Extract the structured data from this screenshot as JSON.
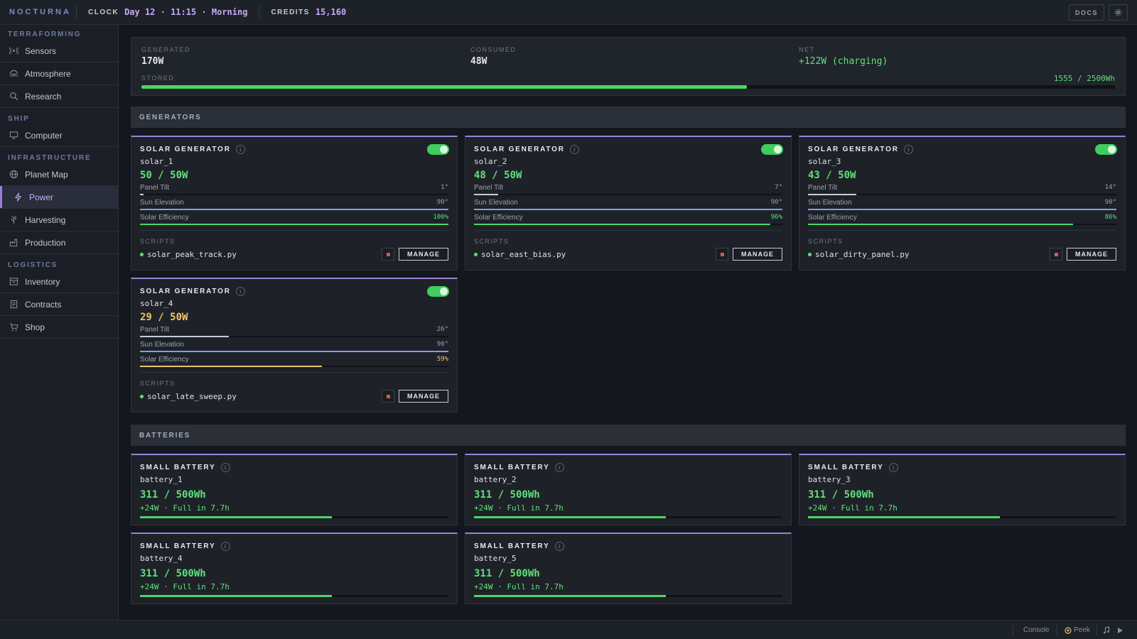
{
  "app": {
    "brand": "NOCTURNA"
  },
  "topbar": {
    "clock_label": "CLOCK",
    "clock_value": "Day 12 · 11:15 · Morning",
    "credits_label": "CREDITS",
    "credits_value": "15,160",
    "docs_label": "DOCS",
    "settings_icon": "gear-icon"
  },
  "sidebar": {
    "sections": [
      {
        "title": "TERRAFORMING",
        "items": [
          {
            "label": "Sensors",
            "icon": "sensor-icon"
          },
          {
            "label": "Atmosphere",
            "icon": "atmosphere-icon"
          },
          {
            "label": "Research",
            "icon": "research-icon"
          }
        ]
      },
      {
        "title": "SHIP",
        "items": [
          {
            "label": "Computer",
            "icon": "computer-icon"
          }
        ]
      },
      {
        "title": "INFRASTRUCTURE",
        "items": [
          {
            "label": "Planet Map",
            "icon": "globe-icon"
          },
          {
            "label": "Power",
            "icon": "bolt-icon",
            "active": true
          },
          {
            "label": "Harvesting",
            "icon": "harvest-icon"
          },
          {
            "label": "Production",
            "icon": "factory-icon"
          }
        ]
      },
      {
        "title": "LOGISTICS",
        "items": [
          {
            "label": "Inventory",
            "icon": "inventory-icon"
          },
          {
            "label": "Contracts",
            "icon": "contract-icon"
          },
          {
            "label": "Shop",
            "icon": "cart-icon"
          }
        ]
      }
    ]
  },
  "summary": {
    "generated_label": "GENERATED",
    "generated_value": "170W",
    "consumed_label": "CONSUMED",
    "consumed_value": "48W",
    "net_label": "NET",
    "net_value": "+122W (charging)",
    "stored_label": "STORED",
    "stored_value": "1555 / 2500Wh",
    "stored_fraction": 0.622
  },
  "generators": {
    "section_title": "GENERATORS",
    "scripts_label": "SCRIPTS",
    "manage_label": "MANAGE",
    "metric_labels": {
      "tilt": "Panel Tilt",
      "sun": "Sun Elevation",
      "eff": "Solar Efficiency"
    },
    "items": [
      {
        "type": "SOLAR GENERATOR",
        "id": "solar_1",
        "power": "50 / 50W",
        "status": "good",
        "enabled": true,
        "tilt": "1°",
        "tilt_fraction": 0.011,
        "sun": "90°",
        "sun_fraction": 1.0,
        "eff": "100%",
        "eff_fraction": 1.0,
        "script": "solar_peak_track.py"
      },
      {
        "type": "SOLAR GENERATOR",
        "id": "solar_2",
        "power": "48 / 50W",
        "status": "good",
        "enabled": true,
        "tilt": "7°",
        "tilt_fraction": 0.078,
        "sun": "90°",
        "sun_fraction": 1.0,
        "eff": "96%",
        "eff_fraction": 0.96,
        "script": "solar_east_bias.py"
      },
      {
        "type": "SOLAR GENERATOR",
        "id": "solar_3",
        "power": "43 / 50W",
        "status": "good",
        "enabled": true,
        "tilt": "14°",
        "tilt_fraction": 0.156,
        "sun": "90°",
        "sun_fraction": 1.0,
        "eff": "86%",
        "eff_fraction": 0.86,
        "script": "solar_dirty_panel.py"
      },
      {
        "type": "SOLAR GENERATOR",
        "id": "solar_4",
        "power": "29 / 50W",
        "status": "warn",
        "enabled": true,
        "tilt": "26°",
        "tilt_fraction": 0.289,
        "sun": "90°",
        "sun_fraction": 1.0,
        "eff": "59%",
        "eff_fraction": 0.59,
        "script": "solar_late_sweep.py"
      }
    ]
  },
  "batteries": {
    "section_title": "BATTERIES",
    "items": [
      {
        "type": "SMALL BATTERY",
        "id": "battery_1",
        "energy": "311 / 500Wh",
        "rate": "+24W · Full in 7.7h",
        "fraction": 0.622
      },
      {
        "type": "SMALL BATTERY",
        "id": "battery_2",
        "energy": "311 / 500Wh",
        "rate": "+24W · Full in 7.7h",
        "fraction": 0.622
      },
      {
        "type": "SMALL BATTERY",
        "id": "battery_3",
        "energy": "311 / 500Wh",
        "rate": "+24W · Full in 7.7h",
        "fraction": 0.622
      },
      {
        "type": "SMALL BATTERY",
        "id": "battery_4",
        "energy": "311 / 500Wh",
        "rate": "+24W · Full in 7.7h",
        "fraction": 0.622
      },
      {
        "type": "SMALL BATTERY",
        "id": "battery_5",
        "energy": "311 / 500Wh",
        "rate": "+24W · Full in 7.7h",
        "fraction": 0.622
      }
    ]
  },
  "bottombar": {
    "console_label": "Console",
    "peek_label": "Peek",
    "music_icon": "music-icon",
    "play_icon": "play-icon"
  },
  "colors": {
    "accent": "#9b7ae0",
    "good": "#5fe07b",
    "warn": "#f2c56b",
    "stop": "#e0514f"
  }
}
